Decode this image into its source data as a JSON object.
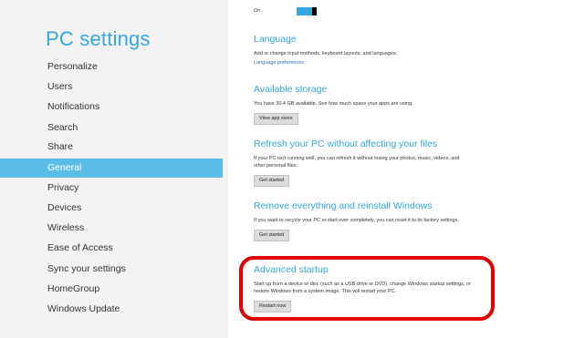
{
  "left": {
    "title": "PC settings",
    "nav": [
      {
        "label": "Personalize"
      },
      {
        "label": "Users"
      },
      {
        "label": "Notifications"
      },
      {
        "label": "Search"
      },
      {
        "label": "Share"
      },
      {
        "label": "General",
        "selected": true
      },
      {
        "label": "Privacy"
      },
      {
        "label": "Devices"
      },
      {
        "label": "Wireless"
      },
      {
        "label": "Ease of Access"
      },
      {
        "label": "Sync your settings"
      },
      {
        "label": "HomeGroup"
      },
      {
        "label": "Windows Update"
      }
    ]
  },
  "toggle": {
    "label": "On",
    "state": "on"
  },
  "sections": {
    "language": {
      "title": "Language",
      "desc": "Add or change input methods, keyboard layouts, and languages.",
      "link": "Language preferences"
    },
    "storage": {
      "title": "Available storage",
      "desc": "You have 30.4 GB available. See how much space your apps are using.",
      "button": "View app sizes"
    },
    "refresh": {
      "title": "Refresh your PC without affecting your files",
      "desc": "If your PC isn't running well, you can refresh it without losing your photos, music, videos, and other personal files.",
      "button": "Get started"
    },
    "reinstall": {
      "title": "Remove everything and reinstall Windows",
      "desc": "If you want to recycle your PC or start over completely, you can reset it to its factory settings.",
      "button": "Get started"
    },
    "advanced": {
      "title": "Advanced startup",
      "desc": "Start up from a device or disc (such as a USB drive or DVD), change Windows startup settings, or restore Windows from a system image. This will restart your PC.",
      "button": "Restart now"
    }
  },
  "colors": {
    "accent": "#35a6de",
    "selected_bg": "#5bbde6",
    "highlight": "#e00000"
  }
}
